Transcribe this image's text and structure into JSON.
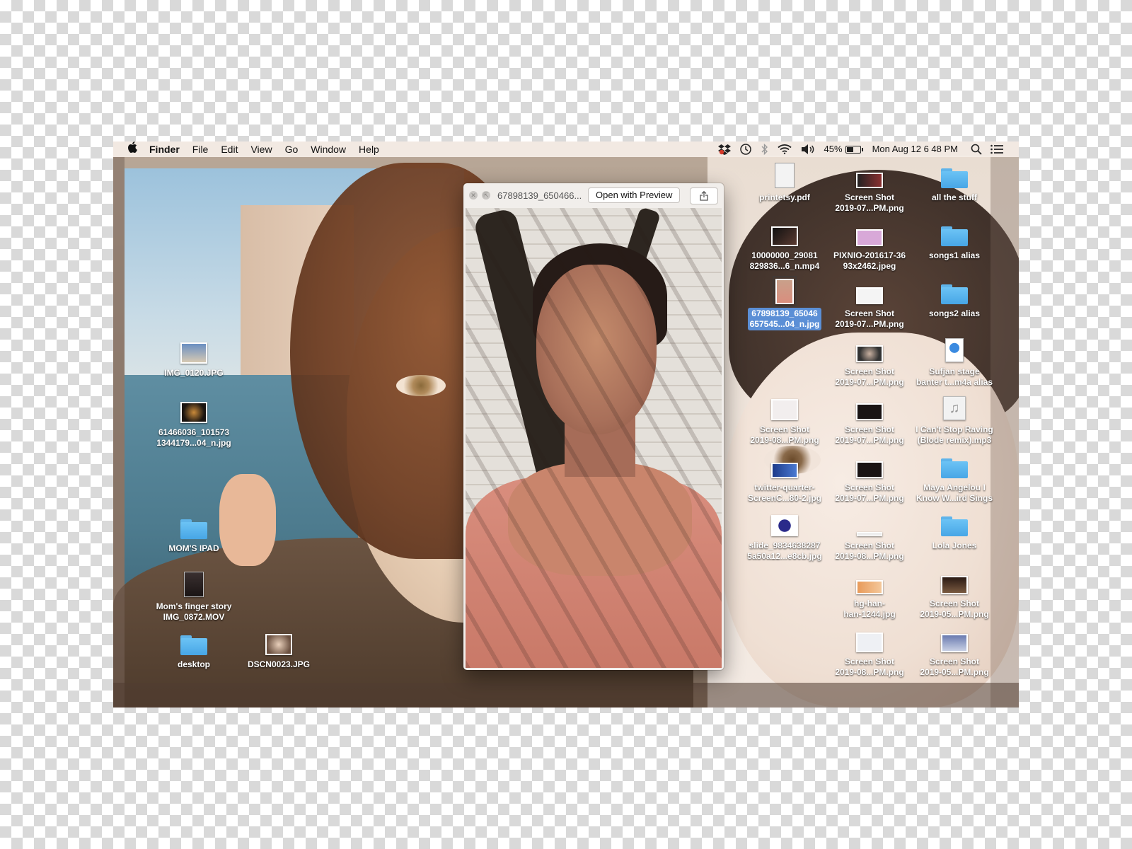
{
  "menubar": {
    "app_name": "Finder",
    "menus": [
      "File",
      "Edit",
      "View",
      "Go",
      "Window",
      "Help"
    ],
    "status": {
      "battery_percent": "45%",
      "datetime": "Mon Aug 12  6 48 PM",
      "icons": [
        "dropbox-icon",
        "time-machine-icon",
        "bluetooth-icon",
        "wifi-icon",
        "volume-icon",
        "battery-icon",
        "spotlight-icon",
        "notification-center-icon"
      ]
    }
  },
  "quicklook": {
    "title": "67898139_650466...",
    "open_button": "Open with Preview",
    "icons": [
      "close-icon",
      "fullscreen-icon",
      "share-icon"
    ]
  },
  "desktop_icons": [
    {
      "label": "IMG_0120.JPG",
      "kind": "image"
    },
    {
      "label": "61466036_101573\n1344179...04_n.jpg",
      "kind": "image"
    },
    {
      "label": "MOM'S IPAD",
      "kind": "folder"
    },
    {
      "label": "Mom's finger story\nIMG_0872.MOV",
      "kind": "video"
    },
    {
      "label": "desktop",
      "kind": "folder"
    },
    {
      "label": "DSCN0023.JPG",
      "kind": "image"
    },
    {
      "label": "printetsy.pdf",
      "kind": "pdf"
    },
    {
      "label": "Screen Shot\n2019-07...PM.png",
      "kind": "image"
    },
    {
      "label": "all the stuff",
      "kind": "folder"
    },
    {
      "label": "10000000_29081\n829836...6_n.mp4",
      "kind": "video"
    },
    {
      "label": "PIXNIO-201617-36\n93x2462.jpeg",
      "kind": "image"
    },
    {
      "label": "songs1 alias",
      "kind": "folder"
    },
    {
      "label": "67898139_65046\n657545...04_n.jpg",
      "kind": "image",
      "selected": true
    },
    {
      "label": "Screen Shot\n2019-07...PM.png",
      "kind": "image"
    },
    {
      "label": "songs2 alias",
      "kind": "folder"
    },
    {
      "label": "Screen Shot\n2019-07...PM.png",
      "kind": "image"
    },
    {
      "label": "Sufjan stage\nbanter t...m4a alias",
      "kind": "doc"
    },
    {
      "label": "Screen Shot\n2019-08...PM.png",
      "kind": "image"
    },
    {
      "label": "Screen Shot\n2019-07...PM.png",
      "kind": "image"
    },
    {
      "label": "I Can't Stop Raving\n(Blode remix).mp3",
      "kind": "audio"
    },
    {
      "label": "twitter-quarter-\nScreenC...80-2.jpg",
      "kind": "image"
    },
    {
      "label": "Screen Shot\n2019-07...PM.png",
      "kind": "image"
    },
    {
      "label": "Maya Angelou I\nKnow W...ird Sings",
      "kind": "folder"
    },
    {
      "label": "slide_9834638287\n5a50a12...e8cb.jpg",
      "kind": "image"
    },
    {
      "label": "Screen Shot\n2019-08...PM.png",
      "kind": "image"
    },
    {
      "label": "Lola Jones",
      "kind": "folder"
    },
    {
      "label": "hg-han-\nhan-1244.jpg",
      "kind": "image"
    },
    {
      "label": "Screen Shot\n2019-05...PM.png",
      "kind": "image"
    },
    {
      "label": "Screen Shot\n2019-08...PM.png",
      "kind": "image"
    },
    {
      "label": "Screen Shot\n2019-05...PM.png",
      "kind": "image"
    }
  ],
  "colors": {
    "selection": "#5b8fd6",
    "folder": "#5fb4ea",
    "menubar": "#f4ece6"
  }
}
